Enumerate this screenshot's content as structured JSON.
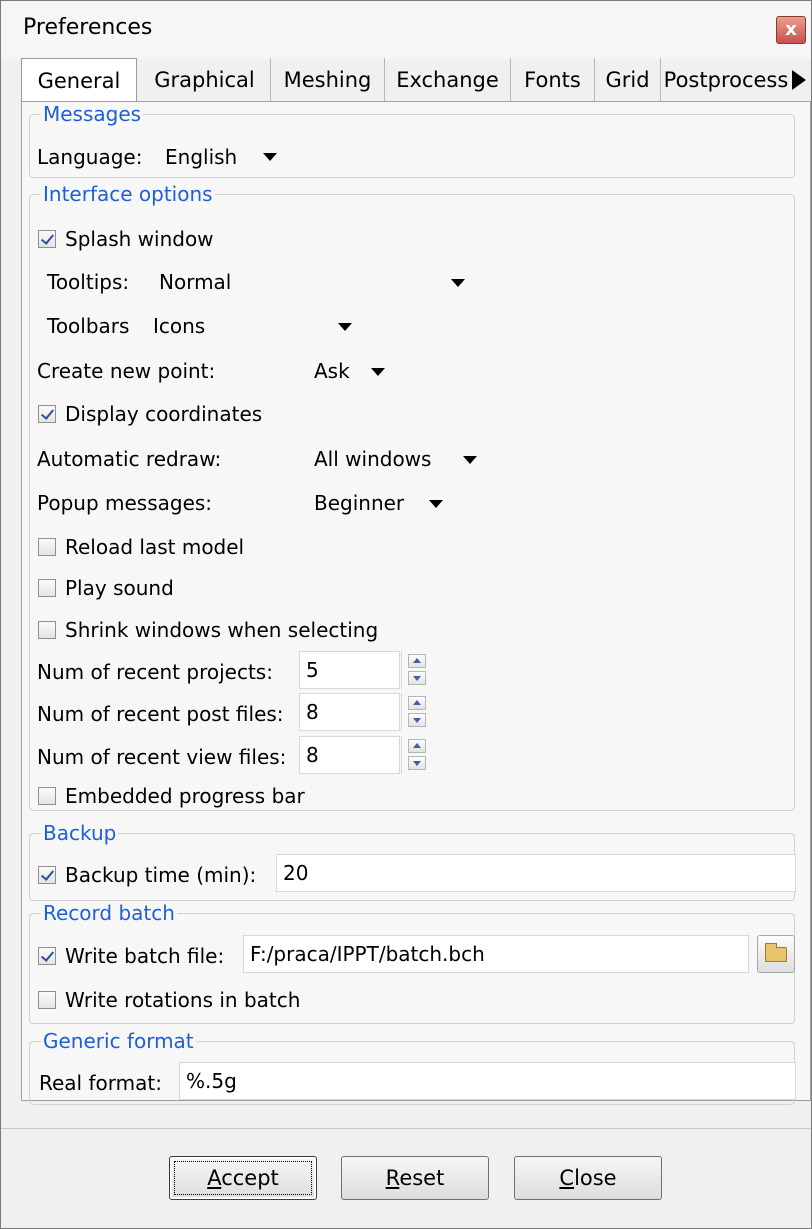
{
  "window": {
    "title": "Preferences",
    "close_glyph": "x"
  },
  "tabs": [
    {
      "label": "General"
    },
    {
      "label": "Graphical"
    },
    {
      "label": "Meshing"
    },
    {
      "label": "Exchange"
    },
    {
      "label": "Fonts"
    },
    {
      "label": "Grid"
    },
    {
      "label": "Postprocess"
    }
  ],
  "messages": {
    "legend": "Messages",
    "language_label": "Language:",
    "language_value": "English"
  },
  "interface": {
    "legend": "Interface options",
    "splash_label": "Splash window",
    "splash_checked": true,
    "tooltips_label": "Tooltips:",
    "tooltips_value": "Normal",
    "toolbars_label": "Toolbars",
    "toolbars_value": "Icons",
    "new_point_label": "Create new point:",
    "new_point_value": "Ask",
    "display_coords_label": "Display coordinates",
    "display_coords_checked": true,
    "redraw_label": "Automatic redraw:",
    "redraw_value": "All windows",
    "popup_label": "Popup messages:",
    "popup_value": "Beginner",
    "reload_label": "Reload last model",
    "reload_checked": false,
    "sound_label": "Play sound",
    "sound_checked": false,
    "shrink_label": "Shrink windows when selecting",
    "shrink_checked": false,
    "recent_projects_label": "Num of recent projects:",
    "recent_projects_value": "5",
    "recent_post_label": "Num of recent post files:",
    "recent_post_value": "8",
    "recent_view_label": "Num of recent view files:",
    "recent_view_value": "8",
    "progress_label": "Embedded progress bar",
    "progress_checked": false
  },
  "backup": {
    "legend": "Backup",
    "label": "Backup time (min):",
    "checked": true,
    "value": "20"
  },
  "record": {
    "legend": "Record batch",
    "write_label": "Write batch file:",
    "write_checked": true,
    "path": "F:/praca/IPPT/batch.bch",
    "rotations_label": "Write rotations in batch",
    "rotations_checked": false
  },
  "generic": {
    "legend": "Generic format",
    "label": "Real format:",
    "value": "%.5g"
  },
  "buttons": {
    "accept_mnemonic": "A",
    "accept_rest": "ccept",
    "reset_mnemonic": "R",
    "reset_rest": "eset",
    "close_mnemonic": "C",
    "close_rest": "lose"
  },
  "icons": {
    "folder": "folder-open-icon",
    "dropdown": "dropdown-arrow-icon",
    "spinner": "spinner-icon"
  }
}
